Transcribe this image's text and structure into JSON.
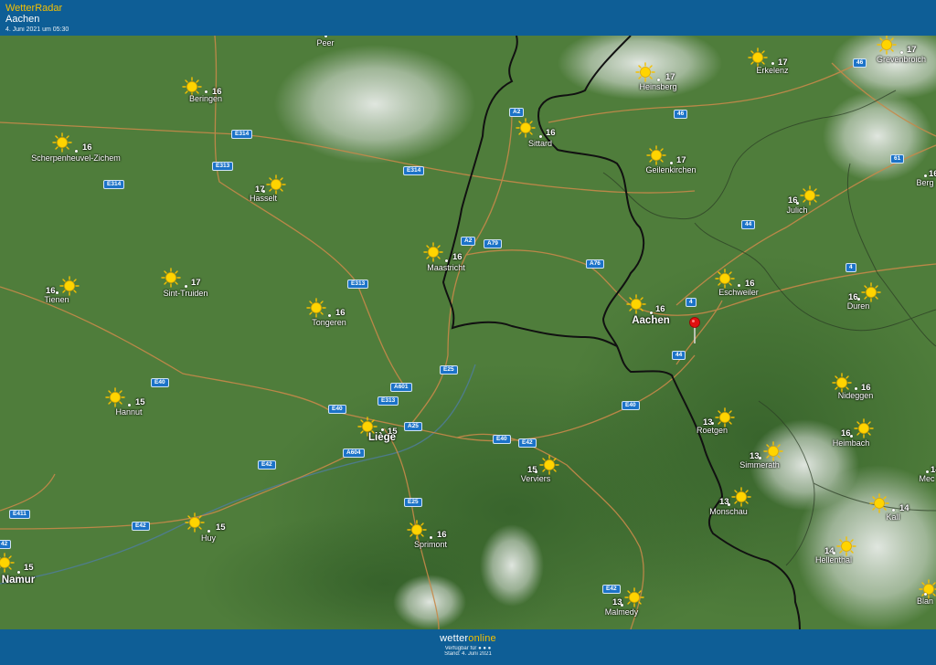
{
  "header": {
    "app_name": "WetterRadar",
    "location": "Aachen",
    "timestamp": "4. Juni 2021 um 05:30"
  },
  "footer": {
    "brand_part1": "wetter",
    "brand_part2": "online",
    "valid_label": "Verfügbar für",
    "stand": "Stand: 4. Juni 2021"
  },
  "colors": {
    "header_bg": "#0e5e96",
    "accent": "#f5c000",
    "map_green": "#4d7a3a",
    "road": "#c7894a",
    "border": "#111111"
  },
  "icons": {
    "weather": "sun-icon",
    "marker": "location-pin-icon"
  },
  "places": [
    {
      "name": "Peer",
      "temp": "",
      "size": "small"
    },
    {
      "name": "Beringen",
      "temp": "16",
      "size": "small"
    },
    {
      "name": "Scherpenheuvel-Zichem",
      "temp": "16",
      "size": "small"
    },
    {
      "name": "Hasselt",
      "temp": "17",
      "size": "small"
    },
    {
      "name": "Tienen",
      "temp": "16",
      "size": "small"
    },
    {
      "name": "Sint-Truiden",
      "temp": "17",
      "size": "small"
    },
    {
      "name": "Tongeren",
      "temp": "16",
      "size": "small"
    },
    {
      "name": "Maastricht",
      "temp": "16",
      "size": "small"
    },
    {
      "name": "Sittard",
      "temp": "16",
      "size": "small"
    },
    {
      "name": "Heinsberg",
      "temp": "17",
      "size": "small"
    },
    {
      "name": "Erkelenz",
      "temp": "17",
      "size": "small"
    },
    {
      "name": "Grevenbroich",
      "temp": "17",
      "size": "small"
    },
    {
      "name": "Geilenkirchen",
      "temp": "17",
      "size": "small"
    },
    {
      "name": "Julich",
      "temp": "16",
      "size": "small"
    },
    {
      "name": "Berg",
      "temp": "16",
      "size": "small"
    },
    {
      "name": "Eschweiler",
      "temp": "16",
      "size": "small"
    },
    {
      "name": "Aachen",
      "temp": "16",
      "size": "big"
    },
    {
      "name": "Duren",
      "temp": "16",
      "size": "small"
    },
    {
      "name": "Hannut",
      "temp": "15",
      "size": "small"
    },
    {
      "name": "Liège",
      "temp": "15",
      "size": "big"
    },
    {
      "name": "Verviers",
      "temp": "15",
      "size": "small"
    },
    {
      "name": "Roetgen",
      "temp": "13",
      "size": "small"
    },
    {
      "name": "Nideggen",
      "temp": "16",
      "size": "small"
    },
    {
      "name": "Heimbach",
      "temp": "16",
      "size": "small"
    },
    {
      "name": "Simmerath",
      "temp": "13",
      "size": "small"
    },
    {
      "name": "Monschau",
      "temp": "13",
      "size": "small"
    },
    {
      "name": "Kall",
      "temp": "14",
      "size": "small"
    },
    {
      "name": "Mec",
      "temp": "14",
      "size": "small"
    },
    {
      "name": "Huy",
      "temp": "15",
      "size": "small"
    },
    {
      "name": "Sprimont",
      "temp": "16",
      "size": "small"
    },
    {
      "name": "Namur",
      "temp": "15",
      "size": "big"
    },
    {
      "name": "Hellenthal",
      "temp": "14",
      "size": "small"
    },
    {
      "name": "Malmedy",
      "temp": "13",
      "size": "small"
    },
    {
      "name": "Blan",
      "temp": "",
      "size": "small"
    }
  ],
  "roads": [
    "A2",
    "E314",
    "E313",
    "E314",
    "E314",
    "A2",
    "A79",
    "A76",
    "46",
    "46",
    "61",
    "44",
    "4",
    "4",
    "44",
    "E313",
    "E25",
    "A601",
    "E40",
    "E40",
    "E313",
    "A25",
    "E40",
    "E42",
    "A604",
    "E42",
    "E411",
    "E42",
    "42",
    "E25",
    "E40",
    "E42"
  ]
}
